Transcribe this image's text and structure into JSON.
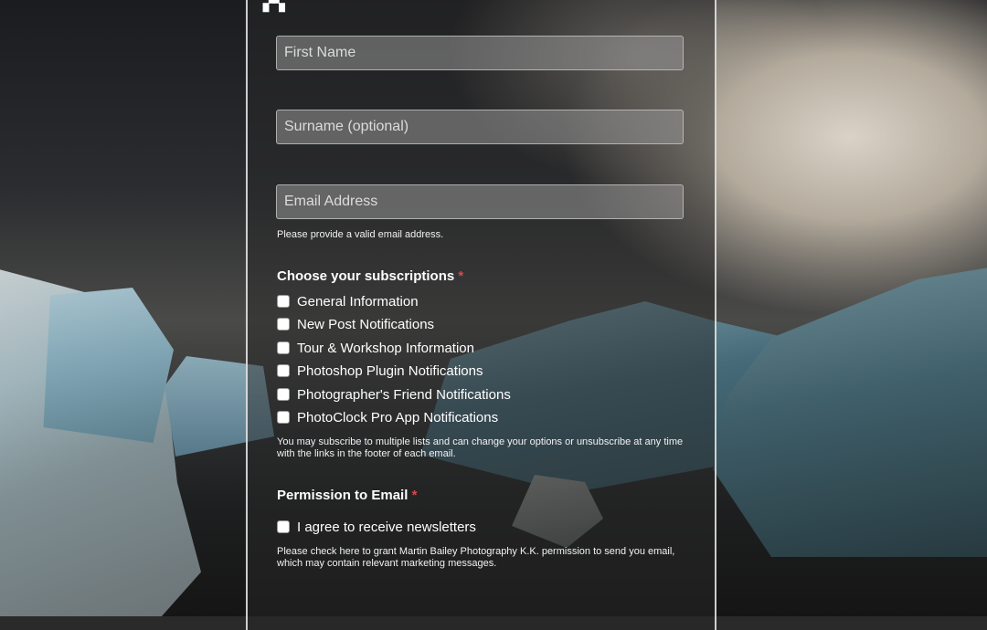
{
  "form": {
    "first_name": {
      "placeholder": "First Name",
      "value": ""
    },
    "surname": {
      "placeholder": "Surname (optional)",
      "value": ""
    },
    "email": {
      "placeholder": "Email Address",
      "value": "",
      "helper": "Please provide a valid email address."
    },
    "subscriptions": {
      "title": "Choose your subscriptions",
      "required_marker": "*",
      "options": [
        {
          "label": "General Information",
          "checked": false
        },
        {
          "label": "New Post Notifications",
          "checked": false
        },
        {
          "label": "Tour & Workshop Information",
          "checked": false
        },
        {
          "label": "Photoshop Plugin Notifications",
          "checked": false
        },
        {
          "label": "Photographer's Friend Notifications",
          "checked": false
        },
        {
          "label": "PhotoClock Pro App Notifications",
          "checked": false
        }
      ],
      "note": "You may subscribe to multiple lists and can change your options or unsubscribe at any time with the links in the footer of each email."
    },
    "permission": {
      "title": "Permission to Email",
      "required_marker": "*",
      "option": {
        "label": "I agree to receive newsletters",
        "checked": false
      },
      "note": "Please check here to grant Martin Bailey Photography K.K. permission to send you email, which may contain relevant marketing messages."
    }
  },
  "colors": {
    "required": "#e0464f",
    "panel_border": "#ebebeb"
  }
}
